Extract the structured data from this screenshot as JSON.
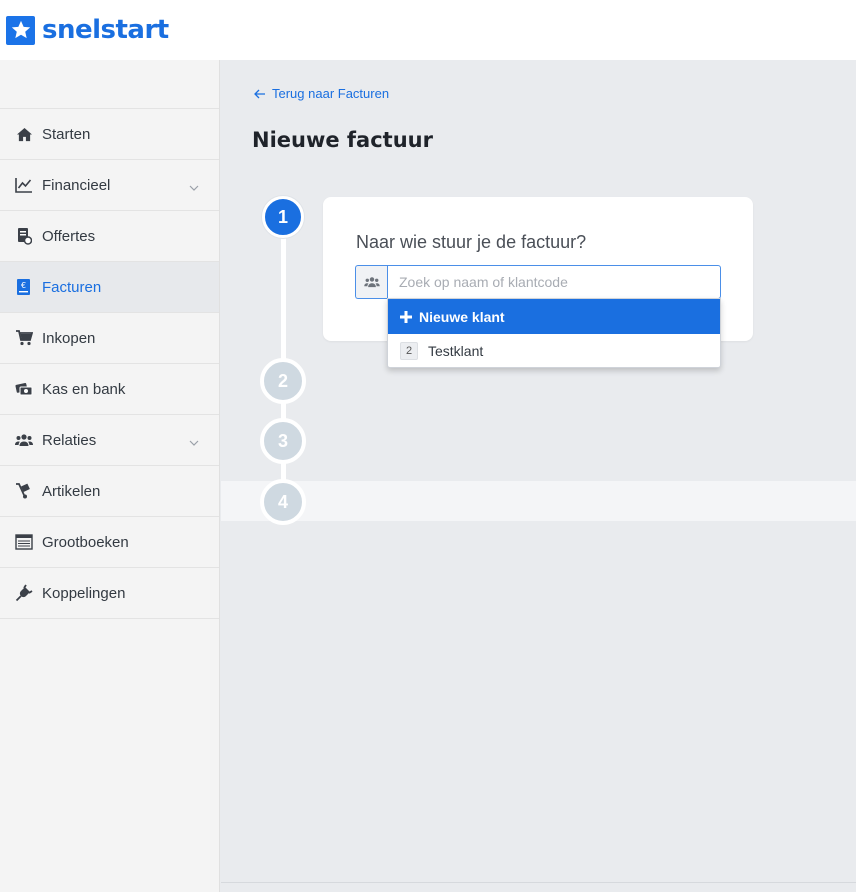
{
  "brand": {
    "name": "snelstart",
    "color": "#1a6fe0"
  },
  "sidebar": {
    "items": [
      {
        "label": "Starten",
        "icon": "home-icon",
        "active": false
      },
      {
        "label": "Financieel",
        "icon": "chart-line-icon",
        "active": false,
        "expandable": true
      },
      {
        "label": "Offertes",
        "icon": "quote-document-icon",
        "active": false
      },
      {
        "label": "Facturen",
        "icon": "invoice-euro-icon",
        "active": true
      },
      {
        "label": "Inkopen",
        "icon": "cart-icon",
        "active": false
      },
      {
        "label": "Kas en bank",
        "icon": "money-icon",
        "active": false
      },
      {
        "label": "Relaties",
        "icon": "users-icon",
        "active": false,
        "expandable": true
      },
      {
        "label": "Artikelen",
        "icon": "hand-truck-icon",
        "active": false
      },
      {
        "label": "Grootboeken",
        "icon": "ledger-icon",
        "active": false
      },
      {
        "label": "Koppelingen",
        "icon": "plug-icon",
        "active": false
      }
    ]
  },
  "main": {
    "back_link": "Terug naar Facturen",
    "title": "Nieuwe factuur",
    "steps": [
      "1",
      "2",
      "3",
      "4"
    ],
    "active_step": 1,
    "question": "Naar wie stuur je de factuur?",
    "search": {
      "placeholder": "Zoek op naam of klantcode",
      "value": ""
    },
    "dropdown": {
      "new_label": "Nieuwe klant",
      "results": [
        {
          "code": "2",
          "name": "Testklant"
        }
      ]
    }
  }
}
